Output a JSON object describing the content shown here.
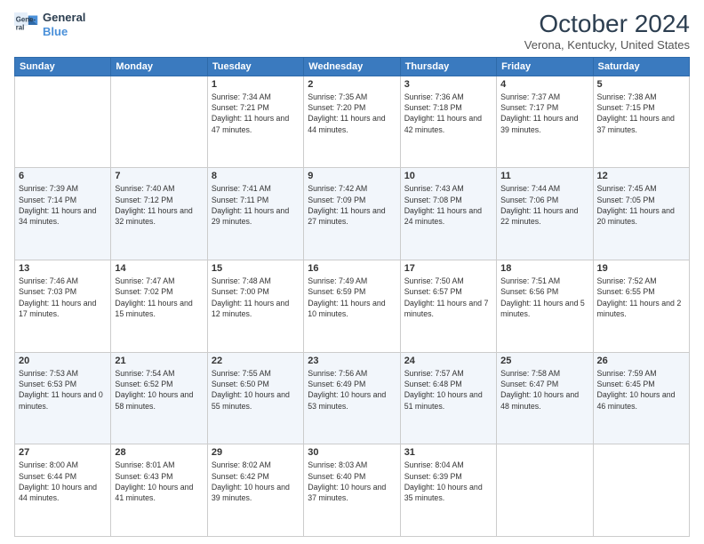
{
  "header": {
    "logo_line1": "General",
    "logo_line2": "Blue",
    "title": "October 2024",
    "subtitle": "Verona, Kentucky, United States"
  },
  "days_of_week": [
    "Sunday",
    "Monday",
    "Tuesday",
    "Wednesday",
    "Thursday",
    "Friday",
    "Saturday"
  ],
  "weeks": [
    [
      {
        "day": "",
        "info": ""
      },
      {
        "day": "",
        "info": ""
      },
      {
        "day": "1",
        "info": "Sunrise: 7:34 AM\nSunset: 7:21 PM\nDaylight: 11 hours and 47 minutes."
      },
      {
        "day": "2",
        "info": "Sunrise: 7:35 AM\nSunset: 7:20 PM\nDaylight: 11 hours and 44 minutes."
      },
      {
        "day": "3",
        "info": "Sunrise: 7:36 AM\nSunset: 7:18 PM\nDaylight: 11 hours and 42 minutes."
      },
      {
        "day": "4",
        "info": "Sunrise: 7:37 AM\nSunset: 7:17 PM\nDaylight: 11 hours and 39 minutes."
      },
      {
        "day": "5",
        "info": "Sunrise: 7:38 AM\nSunset: 7:15 PM\nDaylight: 11 hours and 37 minutes."
      }
    ],
    [
      {
        "day": "6",
        "info": "Sunrise: 7:39 AM\nSunset: 7:14 PM\nDaylight: 11 hours and 34 minutes."
      },
      {
        "day": "7",
        "info": "Sunrise: 7:40 AM\nSunset: 7:12 PM\nDaylight: 11 hours and 32 minutes."
      },
      {
        "day": "8",
        "info": "Sunrise: 7:41 AM\nSunset: 7:11 PM\nDaylight: 11 hours and 29 minutes."
      },
      {
        "day": "9",
        "info": "Sunrise: 7:42 AM\nSunset: 7:09 PM\nDaylight: 11 hours and 27 minutes."
      },
      {
        "day": "10",
        "info": "Sunrise: 7:43 AM\nSunset: 7:08 PM\nDaylight: 11 hours and 24 minutes."
      },
      {
        "day": "11",
        "info": "Sunrise: 7:44 AM\nSunset: 7:06 PM\nDaylight: 11 hours and 22 minutes."
      },
      {
        "day": "12",
        "info": "Sunrise: 7:45 AM\nSunset: 7:05 PM\nDaylight: 11 hours and 20 minutes."
      }
    ],
    [
      {
        "day": "13",
        "info": "Sunrise: 7:46 AM\nSunset: 7:03 PM\nDaylight: 11 hours and 17 minutes."
      },
      {
        "day": "14",
        "info": "Sunrise: 7:47 AM\nSunset: 7:02 PM\nDaylight: 11 hours and 15 minutes."
      },
      {
        "day": "15",
        "info": "Sunrise: 7:48 AM\nSunset: 7:00 PM\nDaylight: 11 hours and 12 minutes."
      },
      {
        "day": "16",
        "info": "Sunrise: 7:49 AM\nSunset: 6:59 PM\nDaylight: 11 hours and 10 minutes."
      },
      {
        "day": "17",
        "info": "Sunrise: 7:50 AM\nSunset: 6:57 PM\nDaylight: 11 hours and 7 minutes."
      },
      {
        "day": "18",
        "info": "Sunrise: 7:51 AM\nSunset: 6:56 PM\nDaylight: 11 hours and 5 minutes."
      },
      {
        "day": "19",
        "info": "Sunrise: 7:52 AM\nSunset: 6:55 PM\nDaylight: 11 hours and 2 minutes."
      }
    ],
    [
      {
        "day": "20",
        "info": "Sunrise: 7:53 AM\nSunset: 6:53 PM\nDaylight: 11 hours and 0 minutes."
      },
      {
        "day": "21",
        "info": "Sunrise: 7:54 AM\nSunset: 6:52 PM\nDaylight: 10 hours and 58 minutes."
      },
      {
        "day": "22",
        "info": "Sunrise: 7:55 AM\nSunset: 6:50 PM\nDaylight: 10 hours and 55 minutes."
      },
      {
        "day": "23",
        "info": "Sunrise: 7:56 AM\nSunset: 6:49 PM\nDaylight: 10 hours and 53 minutes."
      },
      {
        "day": "24",
        "info": "Sunrise: 7:57 AM\nSunset: 6:48 PM\nDaylight: 10 hours and 51 minutes."
      },
      {
        "day": "25",
        "info": "Sunrise: 7:58 AM\nSunset: 6:47 PM\nDaylight: 10 hours and 48 minutes."
      },
      {
        "day": "26",
        "info": "Sunrise: 7:59 AM\nSunset: 6:45 PM\nDaylight: 10 hours and 46 minutes."
      }
    ],
    [
      {
        "day": "27",
        "info": "Sunrise: 8:00 AM\nSunset: 6:44 PM\nDaylight: 10 hours and 44 minutes."
      },
      {
        "day": "28",
        "info": "Sunrise: 8:01 AM\nSunset: 6:43 PM\nDaylight: 10 hours and 41 minutes."
      },
      {
        "day": "29",
        "info": "Sunrise: 8:02 AM\nSunset: 6:42 PM\nDaylight: 10 hours and 39 minutes."
      },
      {
        "day": "30",
        "info": "Sunrise: 8:03 AM\nSunset: 6:40 PM\nDaylight: 10 hours and 37 minutes."
      },
      {
        "day": "31",
        "info": "Sunrise: 8:04 AM\nSunset: 6:39 PM\nDaylight: 10 hours and 35 minutes."
      },
      {
        "day": "",
        "info": ""
      },
      {
        "day": "",
        "info": ""
      }
    ]
  ]
}
